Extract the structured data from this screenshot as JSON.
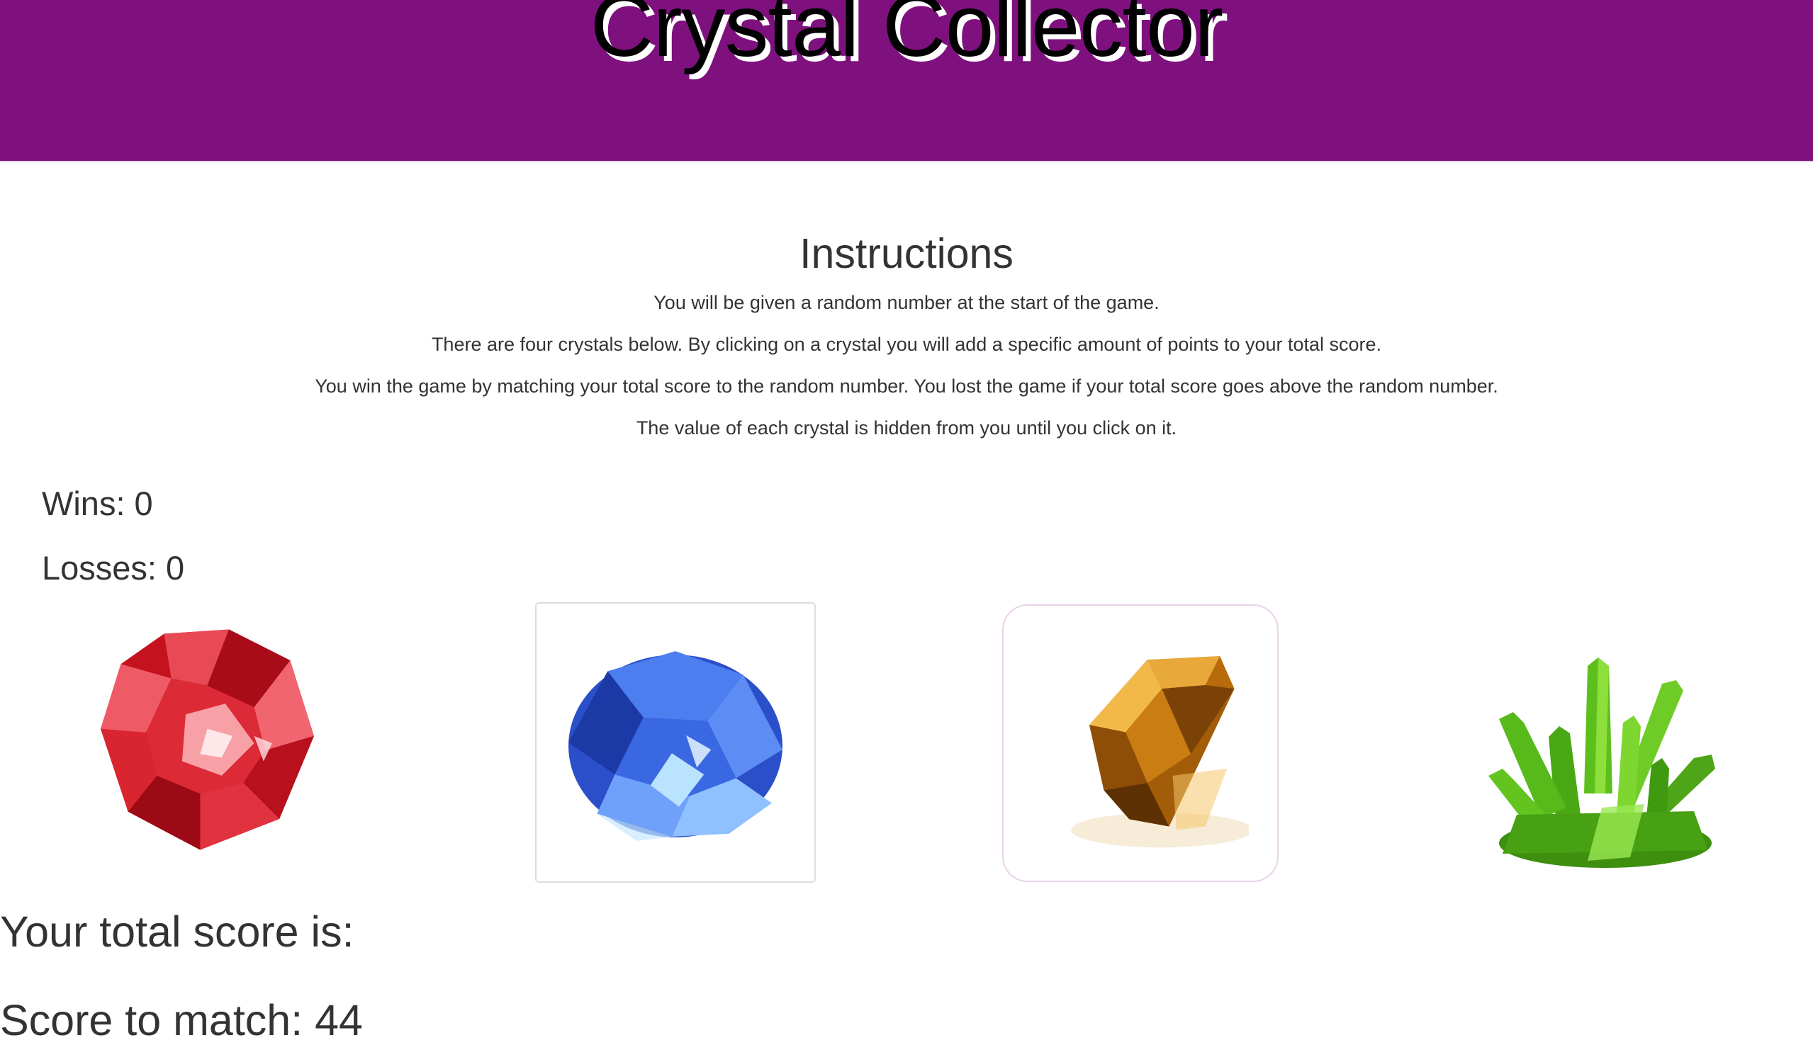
{
  "header": {
    "title": "Crystal Collector"
  },
  "instructions": {
    "heading": "Instructions",
    "lines": [
      "You will be given a random number at the start of the game.",
      "There are four crystals below. By clicking on a crystal you will add a specific amount of points to your total score.",
      "You win the game by matching your total score to the random number. You lost the game if your total score goes above the random number.",
      "The value of each crystal is hidden from you until you click on it."
    ]
  },
  "stats": {
    "wins_label": "Wins: 0",
    "losses_label": "Losses: 0"
  },
  "crystals": [
    {
      "name": "red-crystal",
      "color": "#d4202e"
    },
    {
      "name": "blue-crystal",
      "color": "#2f5fe0"
    },
    {
      "name": "amber-crystal",
      "color": "#d08a14"
    },
    {
      "name": "green-crystal",
      "color": "#52b318"
    }
  ],
  "score": {
    "total_label": "Your total score is:",
    "match_label": "Score to match: 44"
  },
  "colors": {
    "header_bg": "#7f117e",
    "text": "#333333"
  }
}
